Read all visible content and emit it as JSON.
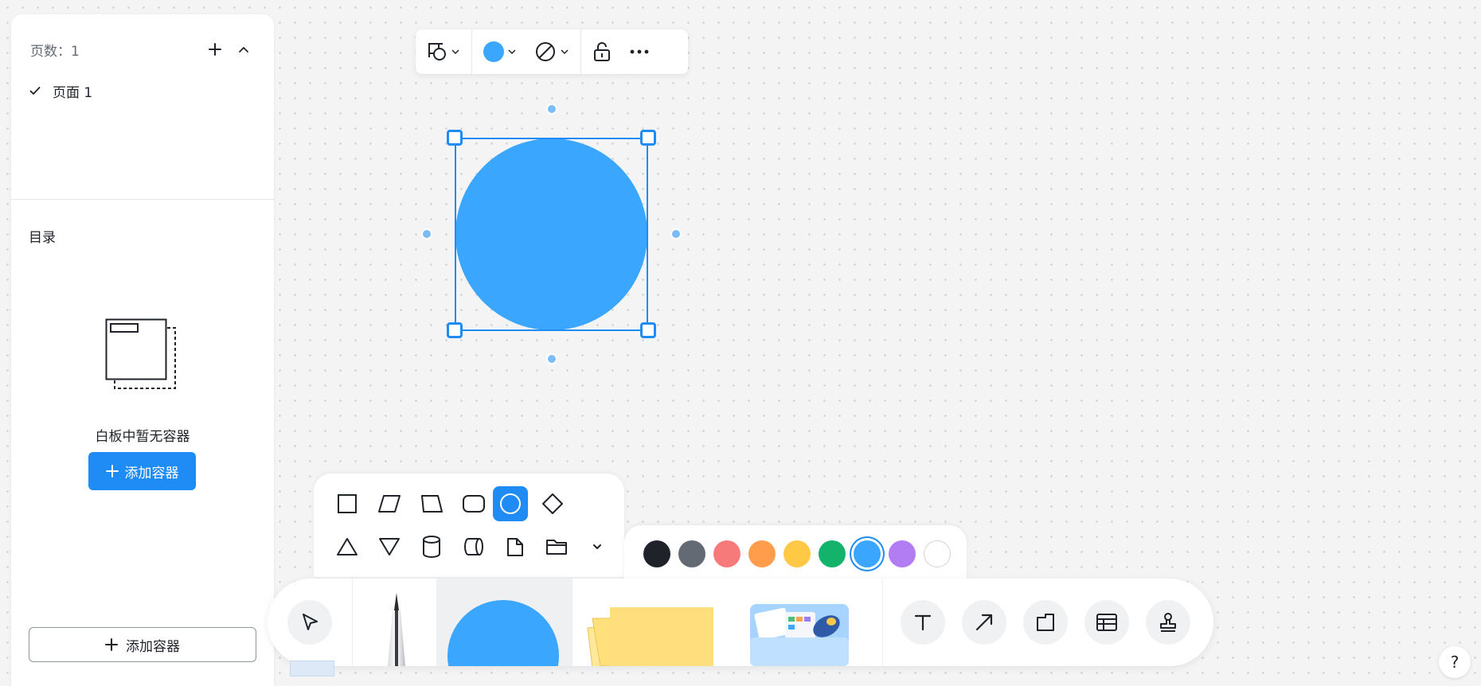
{
  "sidebar": {
    "pages_count_label": "页数：1",
    "pages": [
      {
        "label": "页面 1",
        "checked": true
      }
    ],
    "toc_title": "目录",
    "empty_text": "白板中暂无容器",
    "add_container_primary": "添加容器",
    "add_container_secondary": "添加容器"
  },
  "shape_toolbar": {
    "fill_color": "#3aa6fe",
    "more_icon": "more-horizontal-icon"
  },
  "canvas": {
    "selected_shape": {
      "type": "circle",
      "fill": "#3aa6fe"
    }
  },
  "shape_picker": {
    "row1": [
      "rectangle",
      "parallelogram",
      "trapezoid",
      "rounded-rectangle",
      "circle",
      "diamond"
    ],
    "row2": [
      "triangle",
      "inverted-triangle",
      "cylinder",
      "horizontal-cylinder",
      "document",
      "folder"
    ],
    "selected": "circle"
  },
  "palette": {
    "colors": [
      "#1f2329",
      "#646a73",
      "#f77a7a",
      "#ff9d4d",
      "#ffc845",
      "#14b36b",
      "#3aa6fe",
      "#b27cf3",
      "#ffffff"
    ],
    "selected": "#3aa6fe"
  },
  "main_toolbar": {
    "tools": [
      "select",
      "pen",
      "shape",
      "sticky-note",
      "sticker",
      "text",
      "arrow",
      "frame",
      "table",
      "stamp"
    ]
  },
  "help_label": "?"
}
